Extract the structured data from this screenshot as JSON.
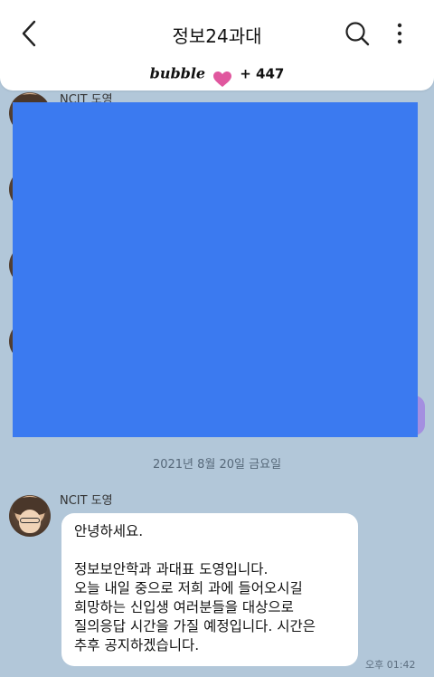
{
  "header": {
    "title": "정보24과대"
  },
  "bubble_bar": {
    "logo_text": "bubble",
    "count": "+ 447"
  },
  "chat": {
    "sender_top": "NCIT 도영",
    "date_divider": "2021년 8월 20일 금요일",
    "message": {
      "sender": "NCIT 도영",
      "lines": [
        "안녕하세요.",
        "",
        "정보보안학과 과대표 도영입니다.",
        "오늘 내일 중으로 저희 과에 들어오시길",
        "희망하는 신입생 여러분들을 대상으로",
        "질의응답 시간을 가질 예정입니다. 시간은",
        "추후 공지하겠습니다."
      ],
      "time": "오후 01:42"
    }
  },
  "colors": {
    "chat_background": "#b2c7d9",
    "redaction": "#3b7af0",
    "heart": "#e0579e"
  },
  "icons": [
    "back-arrow-icon",
    "search-icon",
    "more-vertical-icon",
    "heart-icon"
  ]
}
